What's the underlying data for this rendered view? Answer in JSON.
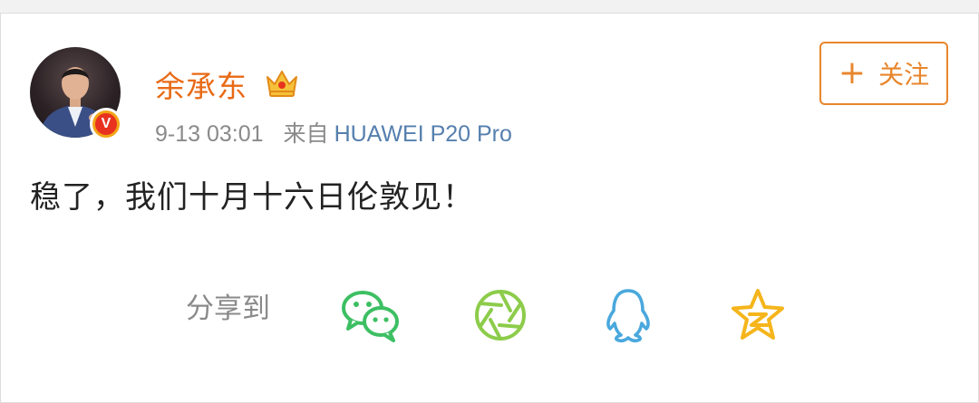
{
  "user": {
    "name": "余承东",
    "verified_badge": "V",
    "membership_icon": "crown-icon"
  },
  "post": {
    "time": "9-13 03:01",
    "source_prefix": "来自",
    "device": "HUAWEI P20 Pro",
    "text": "稳了，我们十月十六日伦敦见！"
  },
  "follow_button": {
    "icon": "plus-icon",
    "label": "关注"
  },
  "share": {
    "label": "分享到",
    "targets": [
      {
        "icon": "wechat-icon"
      },
      {
        "icon": "moments-icon"
      },
      {
        "icon": "qq-icon"
      },
      {
        "icon": "qzone-icon"
      }
    ]
  },
  "colors": {
    "username": "#e86a15",
    "follow": "#e8862c",
    "device_link": "#557fae",
    "wechat": "#3dbf63",
    "moments": "#8ccc4a",
    "qq": "#4aa8dd",
    "qzone": "#f5b51b"
  }
}
